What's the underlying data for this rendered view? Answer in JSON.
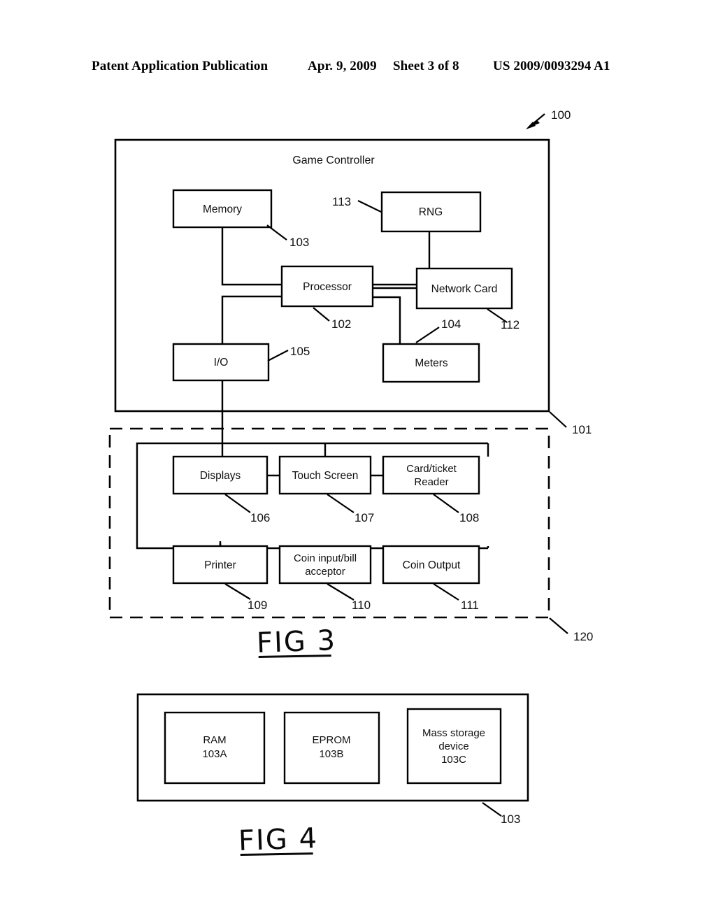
{
  "header": {
    "publication": "Patent Application Publication",
    "date": "Apr. 9, 2009",
    "sheet": "Sheet 3 of 8",
    "patent_number": "US 2009/0093294 A1"
  },
  "fig3": {
    "caption": "FIG 3",
    "game_controller": {
      "title": "Game Controller",
      "ref": "101",
      "blocks": [
        {
          "label": "Memory",
          "ref": "103"
        },
        {
          "label": "RNG",
          "ref": "113"
        },
        {
          "label": "Processor",
          "ref": "102"
        },
        {
          "label": "Network Card",
          "ref": "112"
        },
        {
          "label": "I/O",
          "ref": "105"
        },
        {
          "label": "Meters",
          "ref": "104"
        }
      ]
    },
    "machine_ref": "100",
    "peripherals": {
      "ref": "120",
      "blocks": [
        {
          "label": "Displays",
          "label2": "",
          "ref": "106"
        },
        {
          "label": "Touch Screen",
          "label2": "",
          "ref": "107"
        },
        {
          "label": "Card/ticket",
          "label2": "Reader",
          "ref": "108"
        },
        {
          "label": "Printer",
          "label2": "",
          "ref": "109"
        },
        {
          "label": "Coin input/bill",
          "label2": "acceptor",
          "ref": "110"
        },
        {
          "label": "Coin Output",
          "label2": "",
          "ref": "111"
        }
      ]
    }
  },
  "fig4": {
    "caption": "FIG 4",
    "memory_ref": "103",
    "blocks": [
      {
        "label": "RAM",
        "label2": "",
        "ref": "103A"
      },
      {
        "label": "EPROM",
        "label2": "",
        "ref": "103B"
      },
      {
        "label": "Mass storage",
        "label2": "device",
        "ref": "103C"
      }
    ]
  }
}
